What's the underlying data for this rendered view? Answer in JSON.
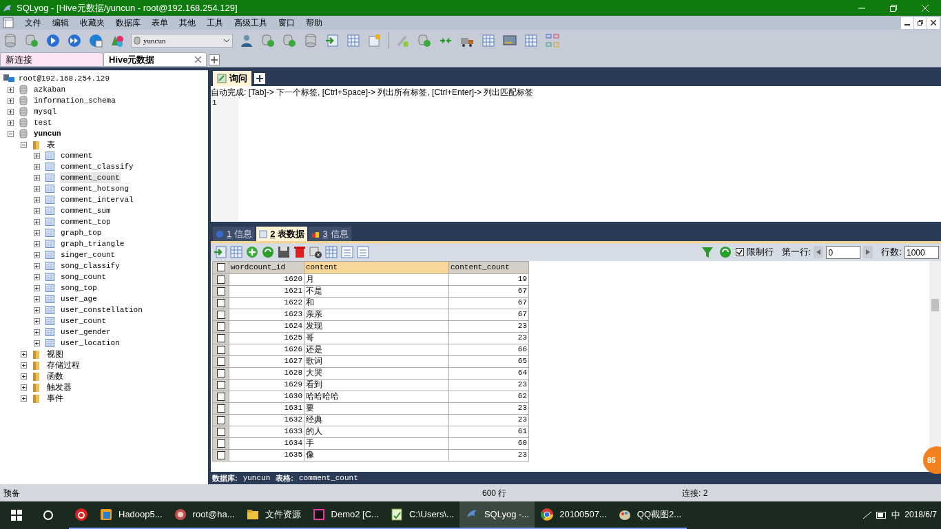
{
  "window": {
    "title": "SQLyog - [Hive元数据/yuncun - root@192.168.254.129]"
  },
  "menu": [
    "文件",
    "编辑",
    "收藏夹",
    "数据库",
    "表单",
    "其他",
    "工具",
    "高级工具",
    "窗口",
    "帮助"
  ],
  "toolbar": {
    "database_select": "yuncun"
  },
  "connection_tabs": [
    {
      "label": "新连接",
      "selected": false,
      "closable": false
    },
    {
      "label": "Hive元数据",
      "selected": true,
      "closable": true
    }
  ],
  "tree": {
    "label": "root@192.168.254.129",
    "children": [
      {
        "label": "azkaban",
        "kind": "database",
        "current": false,
        "expanded": false
      },
      {
        "label": "information_schema",
        "kind": "database",
        "current": false,
        "expanded": false
      },
      {
        "label": "mysql",
        "kind": "database",
        "current": false,
        "expanded": false
      },
      {
        "label": "test",
        "kind": "database",
        "current": false,
        "expanded": false
      },
      {
        "label": "yuncun",
        "kind": "database",
        "current": true,
        "expanded": true,
        "children": [
          {
            "label": "表",
            "kind": "folder",
            "expanded": true,
            "children": [
              {
                "label": "comment",
                "kind": "table",
                "selected": false,
                "expanded": false
              },
              {
                "label": "comment_classify",
                "kind": "table",
                "selected": false,
                "expanded": false
              },
              {
                "label": "comment_count",
                "kind": "table",
                "selected": true,
                "expanded": false
              },
              {
                "label": "comment_hotsong",
                "kind": "table",
                "selected": false,
                "expanded": false
              },
              {
                "label": "comment_interval",
                "kind": "table",
                "selected": false,
                "expanded": false
              },
              {
                "label": "comment_sum",
                "kind": "table",
                "selected": false,
                "expanded": false
              },
              {
                "label": "comment_top",
                "kind": "table",
                "selected": false,
                "expanded": false
              },
              {
                "label": "graph_top",
                "kind": "table",
                "selected": false,
                "expanded": false
              },
              {
                "label": "graph_triangle",
                "kind": "table",
                "selected": false,
                "expanded": false
              },
              {
                "label": "singer_count",
                "kind": "table",
                "selected": false,
                "expanded": false
              },
              {
                "label": "song_classify",
                "kind": "table",
                "selected": false,
                "expanded": false
              },
              {
                "label": "song_count",
                "kind": "table",
                "selected": false,
                "expanded": false
              },
              {
                "label": "song_top",
                "kind": "table",
                "selected": false,
                "expanded": false
              },
              {
                "label": "user_age",
                "kind": "table",
                "selected": false,
                "expanded": false
              },
              {
                "label": "user_constellation",
                "kind": "table",
                "selected": false,
                "expanded": false
              },
              {
                "label": "user_count",
                "kind": "table",
                "selected": false,
                "expanded": false
              },
              {
                "label": "user_gender",
                "kind": "table",
                "selected": false,
                "expanded": false
              },
              {
                "label": "user_location",
                "kind": "table",
                "selected": false,
                "expanded": false
              }
            ]
          },
          {
            "label": "视图",
            "kind": "folder",
            "expanded": false
          },
          {
            "label": "存储过程",
            "kind": "folder",
            "expanded": false
          },
          {
            "label": "函数",
            "kind": "folder",
            "expanded": false
          },
          {
            "label": "触发器",
            "kind": "folder",
            "expanded": false
          },
          {
            "label": "事件",
            "kind": "folder",
            "expanded": false
          }
        ]
      }
    ]
  },
  "query_tabs": [
    {
      "label": "询问",
      "selected": true
    }
  ],
  "editor": {
    "hint": "自动完成: [Tab]-> 下一个标签, [Ctrl+Space]-> 列出所有标签, [Ctrl+Enter]-> 列出匹配标签",
    "line_numbers": [
      "1"
    ]
  },
  "result_tabs": [
    {
      "number": "1",
      "label": "信息",
      "selected": false
    },
    {
      "number": "2",
      "label": "表数据",
      "selected": true
    },
    {
      "number": "3",
      "label": "信息",
      "selected": false
    }
  ],
  "result_toolbar": {
    "limit_rows": {
      "label": "限制行",
      "checked": true
    },
    "first_row_label": "第一行:",
    "first_row": "0",
    "row_count_label": "行数:",
    "row_count": "1000"
  },
  "table": {
    "select_all": {
      "checked": false
    },
    "columns": [
      {
        "label": "wordcount_id",
        "selected": false
      },
      {
        "label": "content",
        "selected": true
      },
      {
        "label": "content_count",
        "selected": false
      }
    ],
    "rows": [
      {
        "checked": false,
        "cells": [
          "1620",
          "月",
          "19"
        ]
      },
      {
        "checked": false,
        "cells": [
          "1621",
          "不是",
          "67"
        ]
      },
      {
        "checked": false,
        "cells": [
          "1622",
          "和",
          "67"
        ]
      },
      {
        "checked": false,
        "cells": [
          "1623",
          "亲亲",
          "67"
        ]
      },
      {
        "checked": false,
        "cells": [
          "1624",
          "发现",
          "23"
        ]
      },
      {
        "checked": false,
        "cells": [
          "1625",
          "哥",
          "23"
        ]
      },
      {
        "checked": false,
        "cells": [
          "1626",
          "还是",
          "66"
        ]
      },
      {
        "checked": false,
        "cells": [
          "1627",
          "歌词",
          "65"
        ]
      },
      {
        "checked": false,
        "cells": [
          "1628",
          "大哭",
          "64"
        ]
      },
      {
        "checked": false,
        "cells": [
          "1629",
          "看到",
          "23"
        ]
      },
      {
        "checked": false,
        "cells": [
          "1630",
          "哈哈哈哈",
          "62"
        ]
      },
      {
        "checked": false,
        "cells": [
          "1631",
          "要",
          "23"
        ]
      },
      {
        "checked": false,
        "cells": [
          "1632",
          "经典",
          "23"
        ]
      },
      {
        "checked": false,
        "cells": [
          "1633",
          "的人",
          "61"
        ]
      },
      {
        "checked": false,
        "cells": [
          "1634",
          "手",
          "60"
        ]
      },
      {
        "checked": false,
        "cells": [
          "1635",
          "像",
          "23"
        ]
      }
    ]
  },
  "info_bar": {
    "db_label": "数据库:",
    "db": "yuncun",
    "table_label": "表格:",
    "table": "comment_count"
  },
  "status_bar": {
    "state": "预备",
    "rows": "600 行",
    "connections": "连接: 2"
  },
  "badge": "85",
  "taskbar": {
    "items": [
      {
        "kind": "music",
        "selected": false
      },
      {
        "label": "Hadoop5...",
        "kind": "app",
        "selected": false
      },
      {
        "label": "root@ha...",
        "kind": "shell",
        "selected": false
      },
      {
        "label": "文件资源",
        "kind": "folder",
        "selected": false
      },
      {
        "label": "Demo2 [C...",
        "kind": "ide",
        "selected": false
      },
      {
        "label": "C:\\Users\\...",
        "kind": "editor",
        "selected": false
      },
      {
        "label": "SQLyog -...",
        "kind": "dolphin",
        "selected": true
      },
      {
        "label": "20100507...",
        "kind": "browser",
        "selected": false
      },
      {
        "label": "QQ截图2...",
        "kind": "paint",
        "selected": false
      }
    ],
    "ime": "中",
    "date": "2018/6/7"
  }
}
